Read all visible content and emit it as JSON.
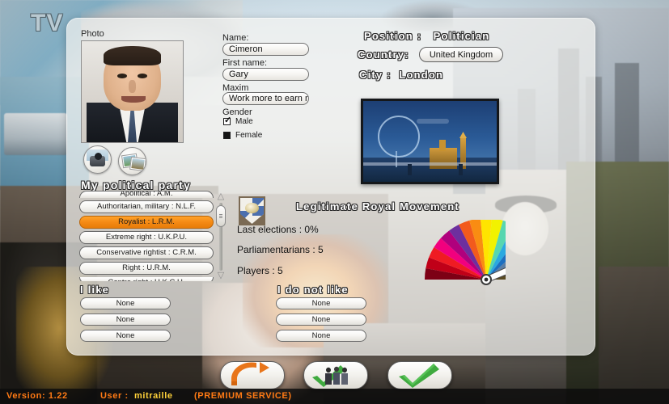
{
  "background": {
    "tv_text": "TV"
  },
  "photo": {
    "label": "Photo",
    "alt": "politician-caricature-portrait",
    "webcam_button_icon": "webcam-icon",
    "gallery_button_icon": "photos-icon"
  },
  "form": {
    "name_label": "Name:",
    "name_value": "Cimeron",
    "first_name_label": "First name:",
    "first_name_value": "Gary",
    "maxim_label": "Maxim",
    "maxim_value": "Work more to earn mo",
    "gender_label": "Gender",
    "male_label": "Male",
    "female_label": "Female",
    "male_checked": true,
    "female_checked": false
  },
  "header": {
    "position_label": "Position :",
    "position_value": "Politician",
    "country_label": "Country:",
    "country_value": "United Kingdom",
    "city_label": "City :",
    "city_value": "London",
    "city_photo_alt": "london-skyline-photo"
  },
  "party_panel": {
    "title": "My political party",
    "items": [
      {
        "label": "Apolitical : A.M.",
        "selected": false,
        "clipped": "top"
      },
      {
        "label": "Authoritarian, military : N.L.F.",
        "selected": false,
        "clipped": ""
      },
      {
        "label": "Royalist : L.R.M.",
        "selected": true,
        "clipped": ""
      },
      {
        "label": "Extreme right : U.K.P.U.",
        "selected": false,
        "clipped": ""
      },
      {
        "label": "Conservative rightist : C.R.M.",
        "selected": false,
        "clipped": ""
      },
      {
        "label": "Right : U.R.M.",
        "selected": false,
        "clipped": ""
      },
      {
        "label": "Centre right : U.K.C.U.",
        "selected": false,
        "clipped": "bottom"
      }
    ],
    "scroll_up_icon": "chevron-up-icon",
    "scroll_down_icon": "chevron-down-icon"
  },
  "party_info": {
    "emblem_icon": "party-shield-emblem",
    "name": "Legitimate Royal Movement",
    "last_elections_label": "Last elections : 0%",
    "parliamentarians_label": "Parliamentarians  : 5",
    "players_label": "Players : 5",
    "gauge": {
      "name": "political-spectrum-gauge",
      "needle_angle_deg": 22,
      "colors": [
        "#7d0015",
        "#c00018",
        "#ef1b23",
        "#f2007e",
        "#b0007d",
        "#6d2f9e",
        "#f25a1d",
        "#f98c12",
        "#ffe400",
        "#f2f200",
        "#57d6b0",
        "#2aa9e0",
        "#1d6fc0",
        "#5b7fa6",
        "#00207a",
        "#0b0b14",
        "#5a4a22"
      ]
    }
  },
  "preferences": {
    "like_title": "I like",
    "dislike_title": "I do not like",
    "like_items": [
      "None",
      "None",
      "None"
    ],
    "dislike_items": [
      "None",
      "None",
      "None"
    ]
  },
  "actions": {
    "back_icon": "back-arrow-icon",
    "players_icon": "players-validate-icon",
    "validate_icon": "green-check-icon"
  },
  "statusbar": {
    "version": "Version: 1.22",
    "user_label": "User :",
    "user_name": "mitraille",
    "service": "(PREMIUM SERVICE)"
  },
  "colors": {
    "accent_orange": "#f58a15",
    "status_orange": "#ff7a14",
    "status_yellow": "#ffd23a"
  }
}
